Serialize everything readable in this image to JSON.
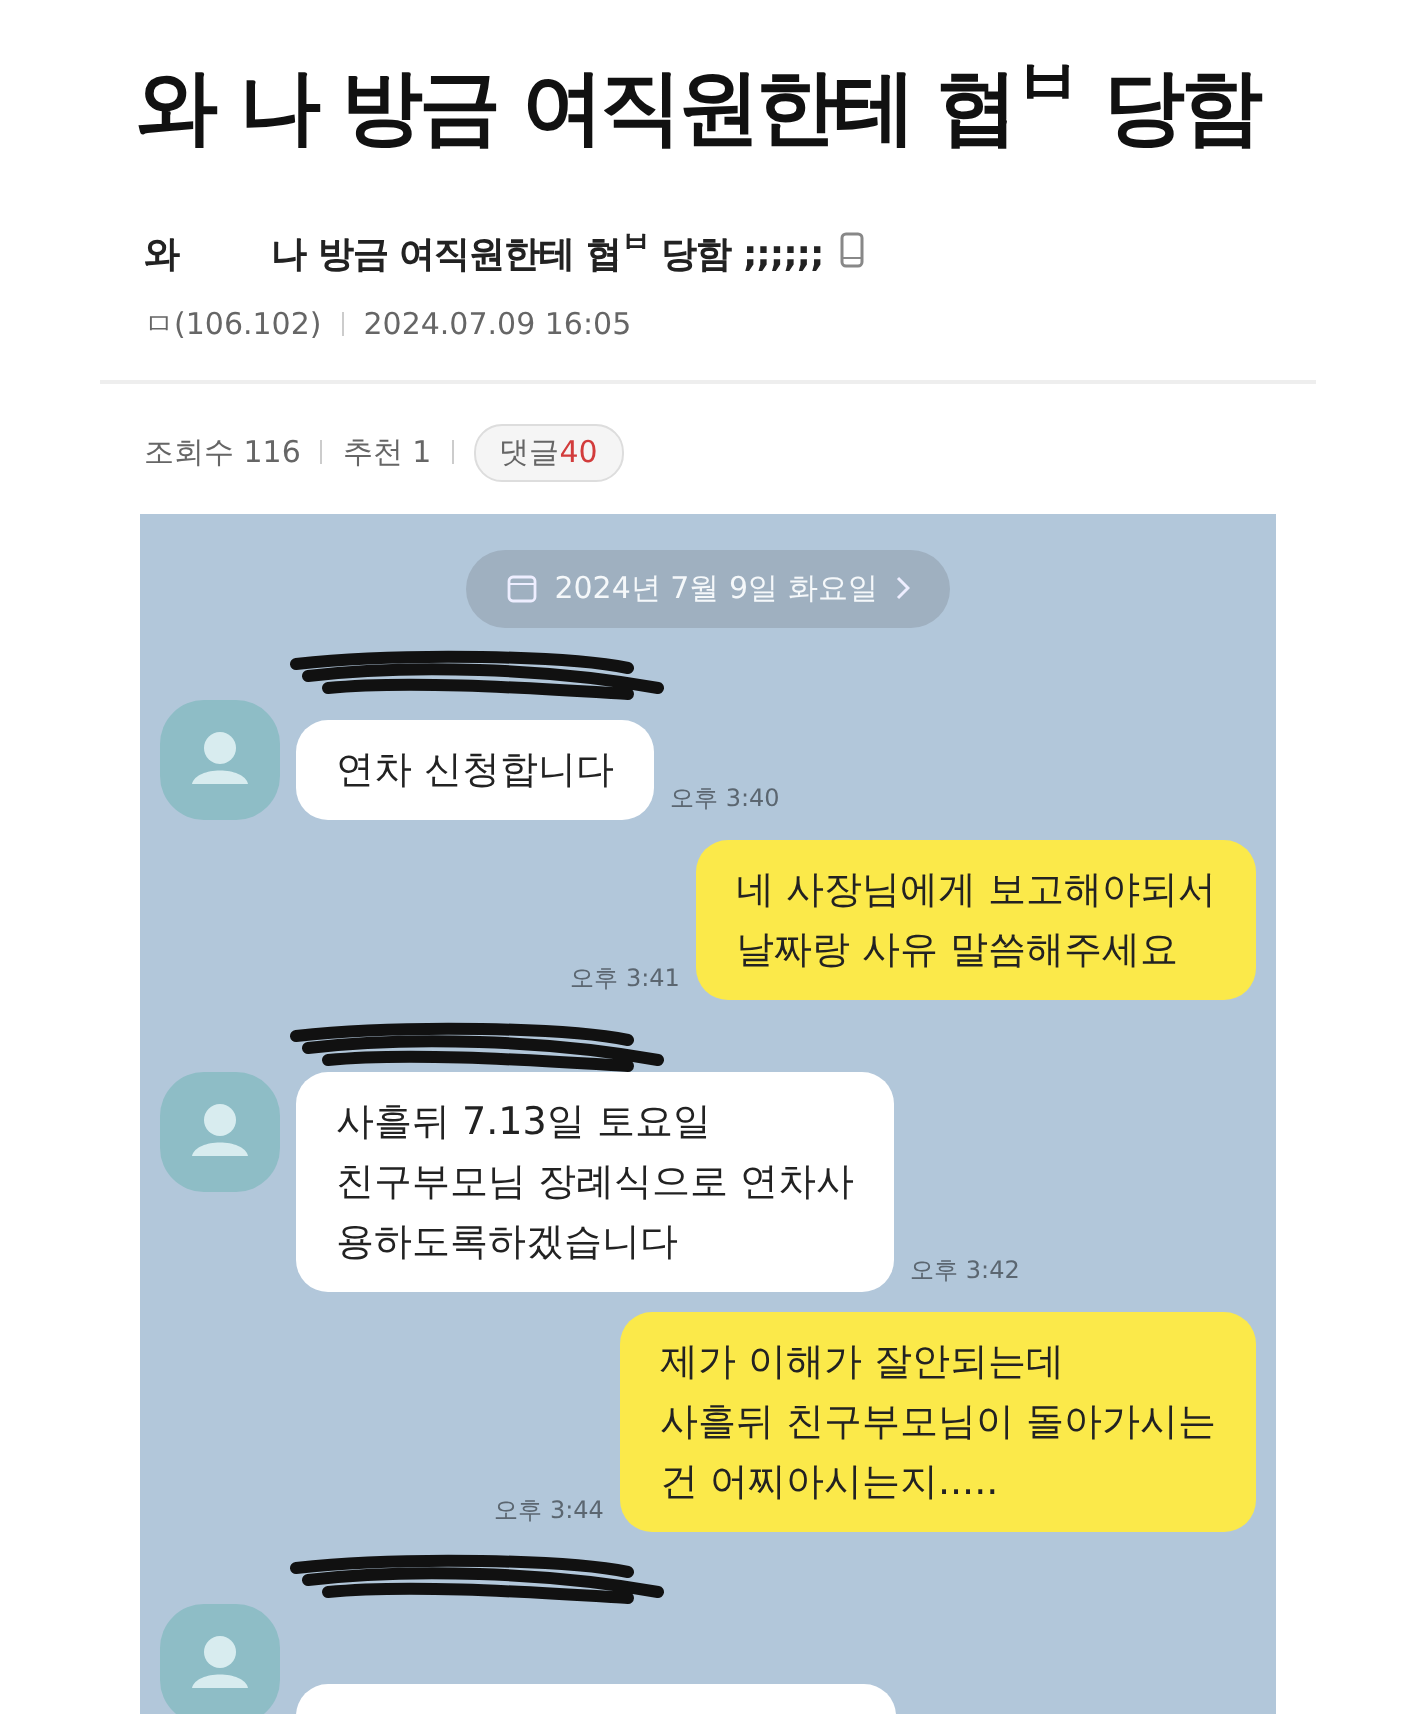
{
  "headline": "와 나 방금 여직원한테 협$^{ㅂ}$ 당함",
  "post": {
    "title": "와        나 방금 여직원한테 협$^{ㅂ}$ 당함 ;;;;;;",
    "author": "ㅁ(106.102)",
    "date": "2024.07.09 16:05",
    "views_label": "조회수 116",
    "likes_label": "추천 1",
    "comments_label": "댓글",
    "comments_count": "40"
  },
  "chat": {
    "date": "2024년 7월 9일 화요일",
    "messages": [
      {
        "kind": "received",
        "text": "연차 신청합니다",
        "time": "오후 3:40"
      },
      {
        "kind": "sent",
        "text": "네 사장님에게 보고해야되서\n날짜랑 사유 말씀해주세요",
        "time": "오후 3:41"
      },
      {
        "kind": "received",
        "text": "사흘뒤 7.13일 토요일\n친구부모님 장례식으로 연차사\n용하도록하겠습니다",
        "time": "오후 3:42"
      },
      {
        "kind": "sent",
        "text": "제가 이해가 잘안되는데\n사흘뒤 친구부모님이 돌아가시는\n건 어찌아시는지.....",
        "time": "오후 3:44"
      },
      {
        "kind": "received"
      }
    ]
  }
}
